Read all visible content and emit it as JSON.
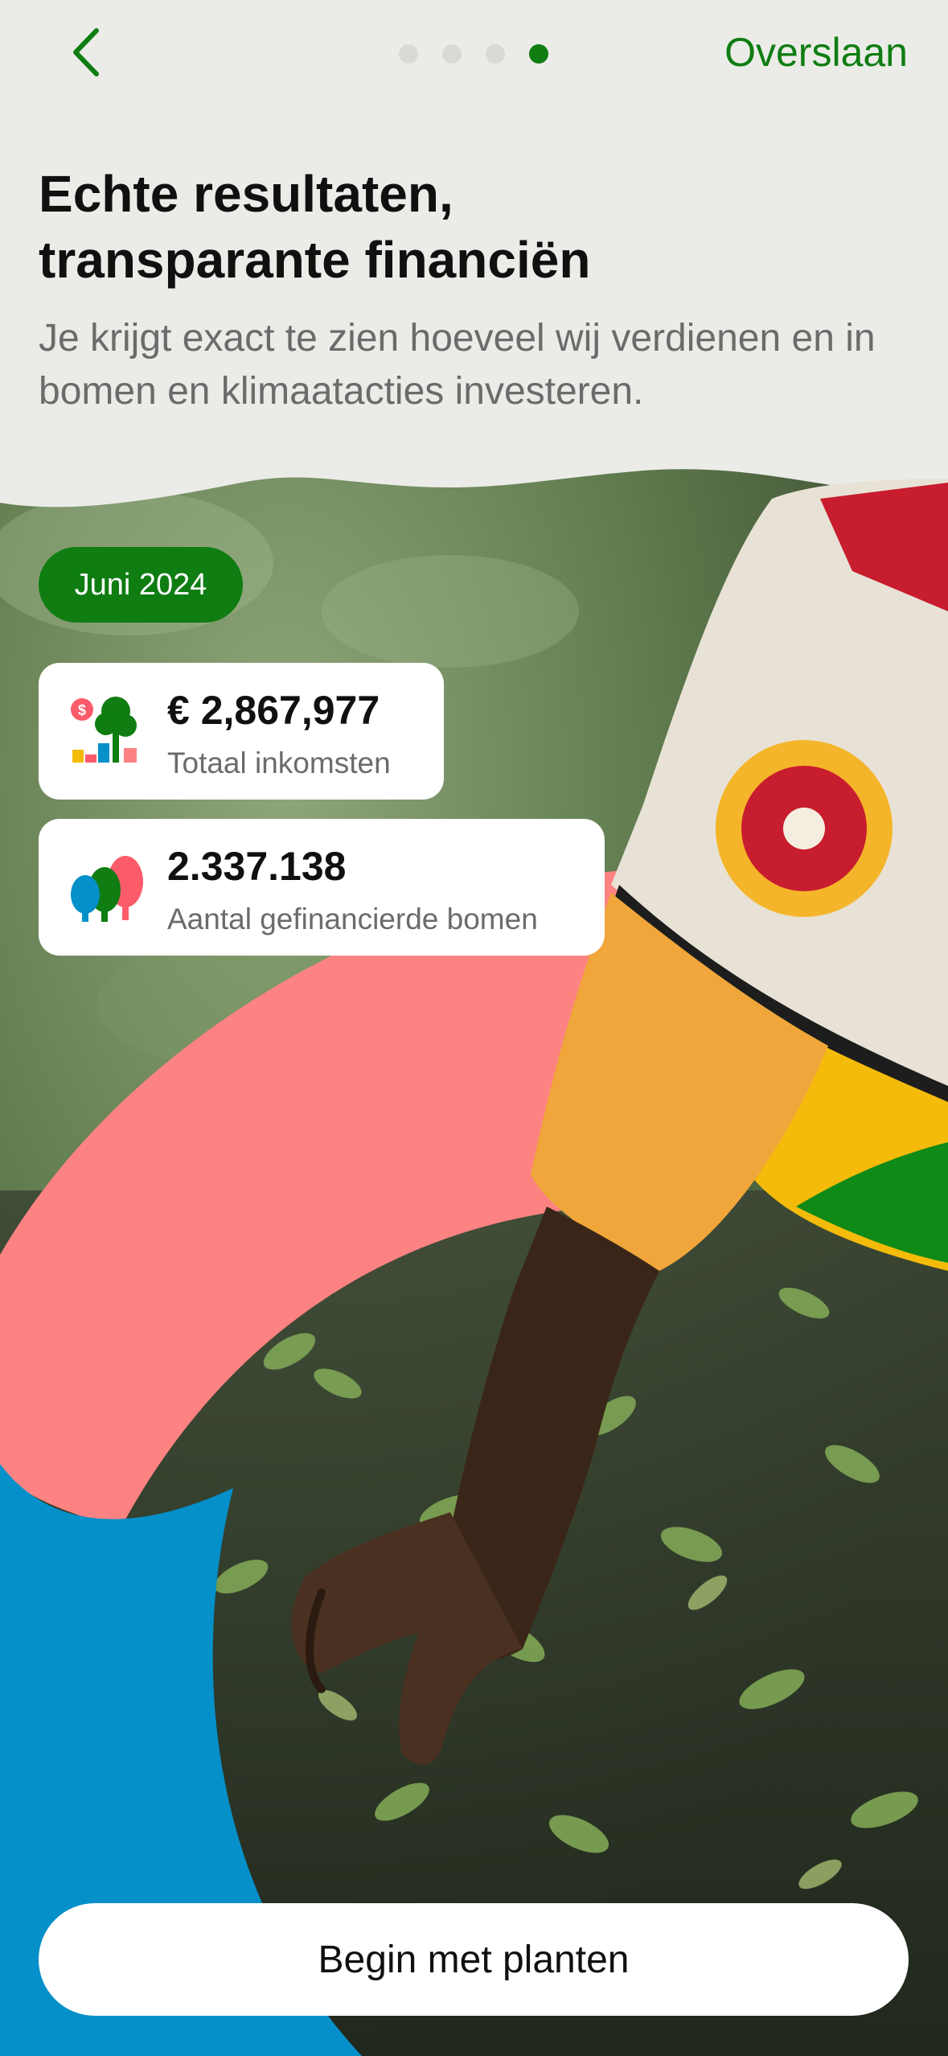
{
  "header": {
    "back_icon": "chevron-left-icon",
    "skip_label": "Overslaan",
    "pagination": {
      "total": 4,
      "current": 4
    }
  },
  "intro": {
    "title_line1": "Echte resultaten,",
    "title_line2": "transparante financiën",
    "subtitle": "Je krijgt exact te zien hoeveel wij verdienen en in bomen en klimaatacties investeren."
  },
  "stats": {
    "month": "Juni 2024",
    "income": {
      "value": "€ 2,867,977",
      "label": "Totaal inkomsten",
      "icon": "income-tree-chart-icon"
    },
    "trees": {
      "value": "2.337.138",
      "label": "Aantal gefinancierde bomen",
      "icon": "trees-icon"
    }
  },
  "cta": {
    "label": "Begin met planten"
  },
  "colors": {
    "accent_green": "#0f7d12",
    "background": "#ebece8",
    "pink": "#fc8382",
    "blue": "#0590c9",
    "yellow": "#f5bb0a"
  }
}
